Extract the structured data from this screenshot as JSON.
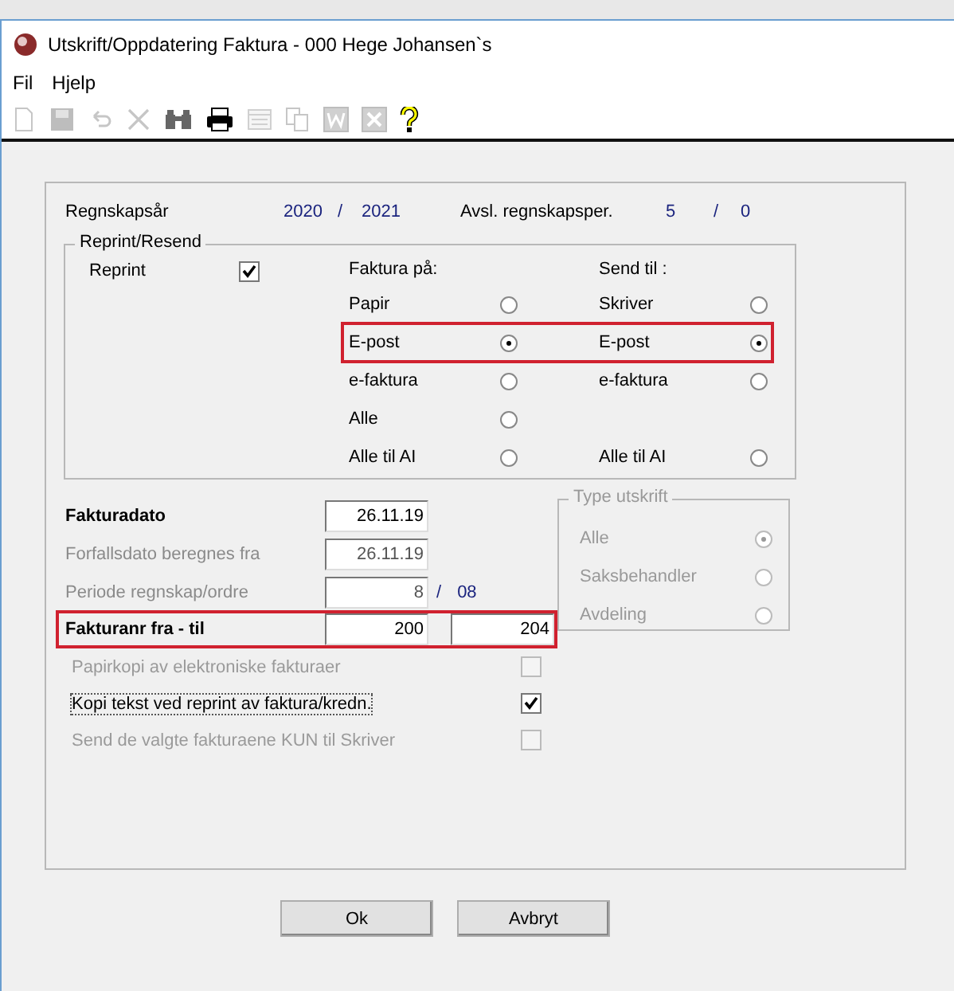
{
  "window": {
    "title": "Utskrift/Oppdatering Faktura - 000 Hege Johansen`s"
  },
  "menu": [
    "Fil",
    "Hjelp"
  ],
  "toolbar": [
    {
      "kind": "new",
      "disabled": true
    },
    {
      "kind": "save",
      "disabled": true
    },
    {
      "kind": "undo",
      "disabled": true
    },
    {
      "kind": "delete",
      "disabled": true
    },
    {
      "kind": "find",
      "disabled": false
    },
    {
      "kind": "print",
      "disabled": false
    },
    {
      "kind": "form",
      "disabled": true
    },
    {
      "kind": "copy",
      "disabled": true
    },
    {
      "kind": "word",
      "disabled": true
    },
    {
      "kind": "excel",
      "disabled": true
    },
    {
      "kind": "help",
      "disabled": false
    }
  ],
  "year_row": {
    "label": "Regnskapsår",
    "from": "2020",
    "separator": "/",
    "to": "2021",
    "closed_label": "Avsl. regnskapsper.",
    "closed_from": "5",
    "closed_separator": "/",
    "closed_to": "0"
  },
  "reprint_group": {
    "legend": "Reprint/Resend",
    "reprint": {
      "label": "Reprint",
      "checked": true
    },
    "faktura_heading": "Faktura på:",
    "send_heading": "Send til :",
    "rows": [
      {
        "faktura": {
          "label": "Papir",
          "selected": false
        },
        "send": {
          "label": "Skriver",
          "selected": false
        },
        "highlighted": false
      },
      {
        "faktura": {
          "label": "E-post",
          "selected": true
        },
        "send": {
          "label": "E-post",
          "selected": true
        },
        "highlighted": true
      },
      {
        "faktura": {
          "label": "e-faktura",
          "selected": false
        },
        "send": {
          "label": "e-faktura",
          "selected": false
        },
        "highlighted": false
      },
      {
        "faktura": {
          "label": "Alle",
          "selected": false
        },
        "highlighted": false
      },
      {
        "faktura": {
          "label": "Alle til AI",
          "selected": false
        },
        "send": {
          "label": "Alle til AI",
          "selected": false
        },
        "highlighted": false
      }
    ]
  },
  "fields": [
    {
      "kind": "single",
      "label": "Fakturadato",
      "value": "26.11.19",
      "enabled": true,
      "highlighted": false
    },
    {
      "kind": "single",
      "label": "Forfallsdato beregnes fra",
      "value": "26.11.19",
      "enabled": false,
      "highlighted": false
    },
    {
      "kind": "period",
      "label": "Periode regnskap/ordre",
      "value": "8",
      "separator": "/",
      "suffix": "08",
      "enabled": false,
      "highlighted": false
    },
    {
      "kind": "range",
      "label": "Fakturanr fra - til",
      "from": "200",
      "to": "204",
      "enabled": true,
      "highlighted": true
    }
  ],
  "checks": [
    {
      "label": "Papirkopi av elektroniske fakturaer",
      "checked": false,
      "enabled": false,
      "focused": false
    },
    {
      "label": "Kopi tekst ved reprint av faktura/kredn.",
      "checked": true,
      "enabled": true,
      "focused": true
    },
    {
      "label": "Send de valgte fakturaene KUN til Skriver",
      "checked": false,
      "enabled": false,
      "focused": false
    }
  ],
  "type_utskrift": {
    "legend": "Type utskrift",
    "enabled": false,
    "options": [
      {
        "label": "Alle",
        "selected": true
      },
      {
        "label": "Saksbehandler",
        "selected": false
      },
      {
        "label": "Avdeling",
        "selected": false
      }
    ]
  },
  "buttons": [
    "Ok",
    "Avbryt"
  ]
}
